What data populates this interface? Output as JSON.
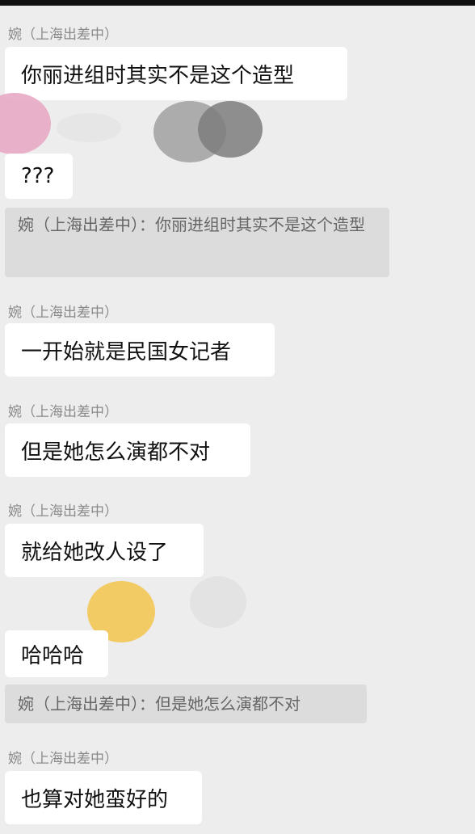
{
  "chat": {
    "messages": [
      {
        "sender": "婉（上海出差中）",
        "text": "你丽进组时其实不是这个造型"
      },
      {
        "text": "???"
      },
      {
        "quote": "婉（上海出差中）：你丽进组时其实不是这个造型"
      },
      {
        "sender": "婉（上海出差中）",
        "text": "一开始就是民国女记者"
      },
      {
        "sender": "婉（上海出差中）",
        "text": "但是她怎么演都不对"
      },
      {
        "sender": "婉（上海出差中）",
        "text": "就给她改人设了"
      },
      {
        "text": "哈哈哈"
      },
      {
        "quote": "婉（上海出差中）：但是她怎么演都不对"
      },
      {
        "sender": "婉（上海出差中）",
        "text": "也算对她蛮好的"
      }
    ]
  },
  "colors": {
    "background": "#ededed",
    "bubble": "#ffffff",
    "quote": "#dcdcdc",
    "sender_text": "#8a8a8a"
  }
}
